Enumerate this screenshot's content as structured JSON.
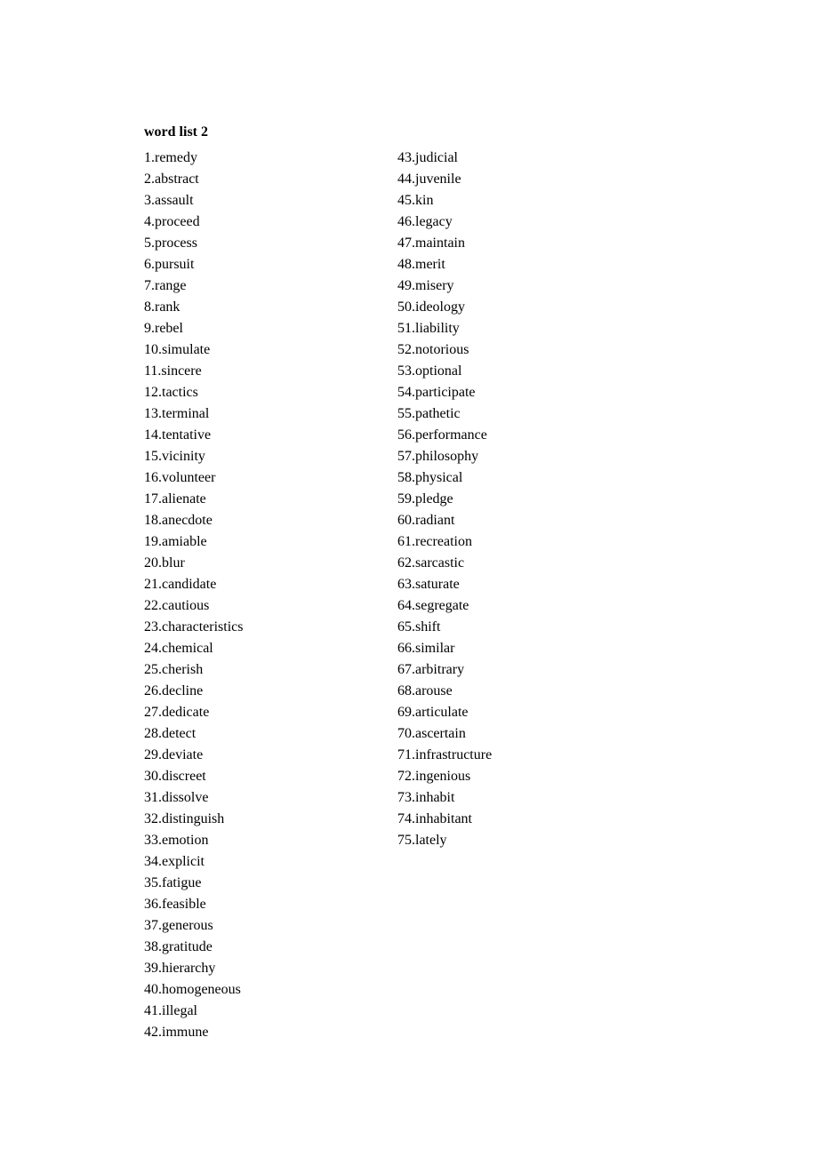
{
  "title": "word list 2",
  "items": [
    "remedy",
    "abstract",
    "assault",
    "proceed",
    "process",
    "pursuit",
    "range",
    "rank",
    "rebel",
    "simulate",
    "sincere",
    "tactics",
    "terminal",
    "tentative",
    "vicinity",
    "volunteer",
    "alienate",
    "anecdote",
    "amiable",
    "blur",
    "candidate",
    "cautious",
    "characteristics",
    "chemical",
    "cherish",
    "decline",
    "dedicate",
    "detect",
    "deviate",
    "discreet",
    "dissolve",
    "distinguish",
    "emotion",
    "explicit",
    "fatigue",
    "feasible",
    "generous",
    "gratitude",
    "hierarchy",
    "homogeneous",
    "illegal",
    "immune",
    "judicial",
    "juvenile",
    "kin",
    "legacy",
    "maintain",
    "merit",
    "misery",
    "ideology",
    "liability",
    "notorious",
    "optional",
    "participate",
    "pathetic",
    "performance",
    "philosophy",
    "physical",
    "pledge",
    "radiant",
    "recreation",
    "sarcastic",
    "saturate",
    "segregate",
    "shift",
    "similar",
    "arbitrary",
    "arouse",
    "articulate",
    "ascertain",
    "infrastructure",
    "ingenious",
    "inhabit",
    "inhabitant",
    "lately"
  ]
}
